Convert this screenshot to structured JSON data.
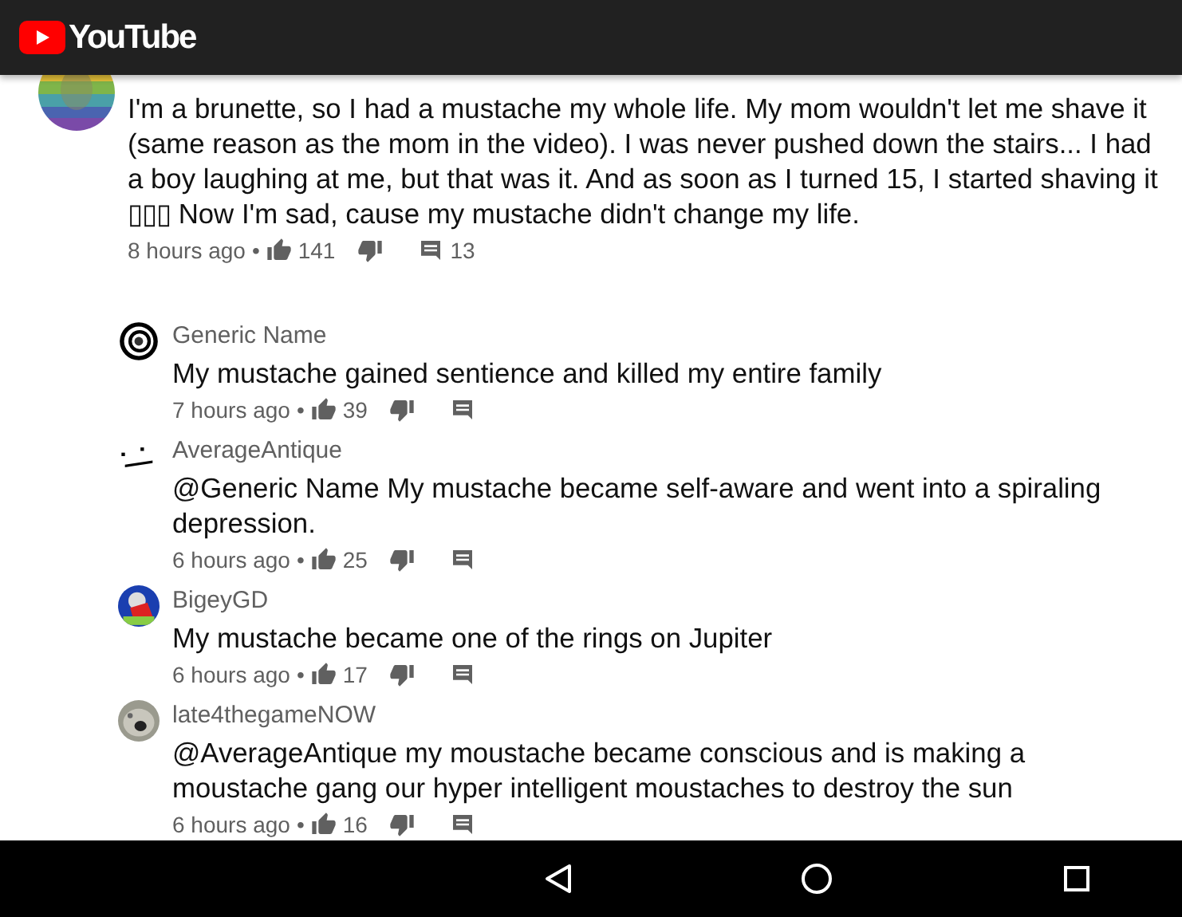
{
  "header": {
    "logo_text": "YouTube"
  },
  "comment": {
    "text": "I'm a brunette,  so I had a mustache my whole life. My mom wouldn't let me shave it (same reason as the mom in the video). I was never pushed down the stairs... I had a boy laughing at me, but that was it. And as soon as I turned 15, I started shaving it ▯▯▯ Now I'm sad, cause my mustache didn't change my life.",
    "time": "8 hours ago",
    "bullet": "•",
    "likes": "141",
    "reply_count": "13",
    "replies": [
      {
        "author": "Generic Name",
        "text": "My mustache gained sentience and killed my entire family",
        "time": "7 hours ago",
        "bullet": "•",
        "likes": "39"
      },
      {
        "author": "AverageAntique",
        "text": "@Generic Name My mustache became self-aware and went into a spiraling depression.",
        "time": "6 hours ago",
        "bullet": "•",
        "likes": "25"
      },
      {
        "author": "BigeyGD",
        "text": "My mustache became one of the rings on Jupiter",
        "time": "6 hours ago",
        "bullet": "•",
        "likes": "17"
      },
      {
        "author": "late4thegameNOW",
        "text": "@AverageAntique my moustache became conscious and is making a moustache gang our hyper intelligent moustaches to destroy the sun",
        "time": "6 hours ago",
        "bullet": "•",
        "likes": "16"
      }
    ]
  }
}
